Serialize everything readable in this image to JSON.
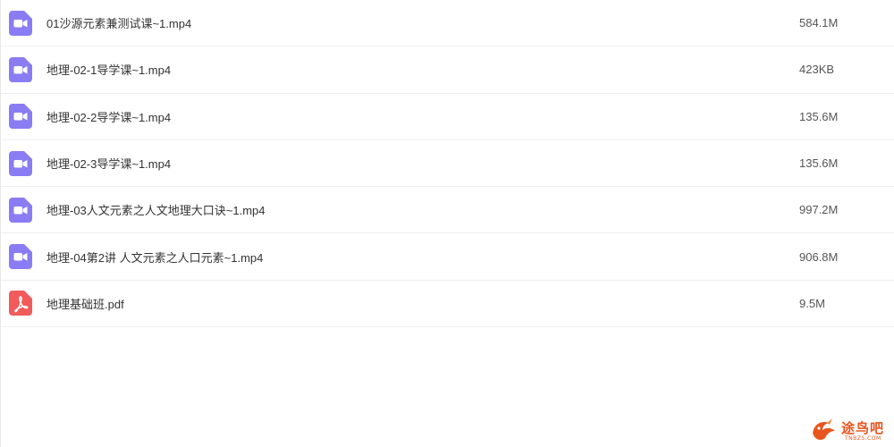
{
  "files": [
    {
      "name": "01沙源元素兼测试课~1.mp4",
      "size": "584.1M",
      "icon": "video-file-icon",
      "icon_color": "#8a7cf3"
    },
    {
      "name": "地理-02-1导学课~1.mp4",
      "size": "423KB",
      "icon": "video-file-icon",
      "icon_color": "#8a7cf3"
    },
    {
      "name": "地理-02-2导学课~1.mp4",
      "size": "135.6M",
      "icon": "video-file-icon",
      "icon_color": "#8a7cf3"
    },
    {
      "name": "地理-02-3导学课~1.mp4",
      "size": "135.6M",
      "icon": "video-file-icon",
      "icon_color": "#8a7cf3"
    },
    {
      "name": "地理-03人文元素之人文地理大口诀~1.mp4",
      "size": "997.2M",
      "icon": "video-file-icon",
      "icon_color": "#8a7cf3"
    },
    {
      "name": "地理-04第2讲 人文元素之人口元素~1.mp4",
      "size": "906.8M",
      "icon": "video-file-icon",
      "icon_color": "#8a7cf3"
    },
    {
      "name": "地理基础班.pdf",
      "size": "9.5M",
      "icon": "pdf-file-icon",
      "icon_color": "#f25b5b"
    }
  ],
  "watermark": {
    "title": "途鸟吧",
    "subtitle": "TNBZS.COM",
    "color": "#e8551f"
  }
}
